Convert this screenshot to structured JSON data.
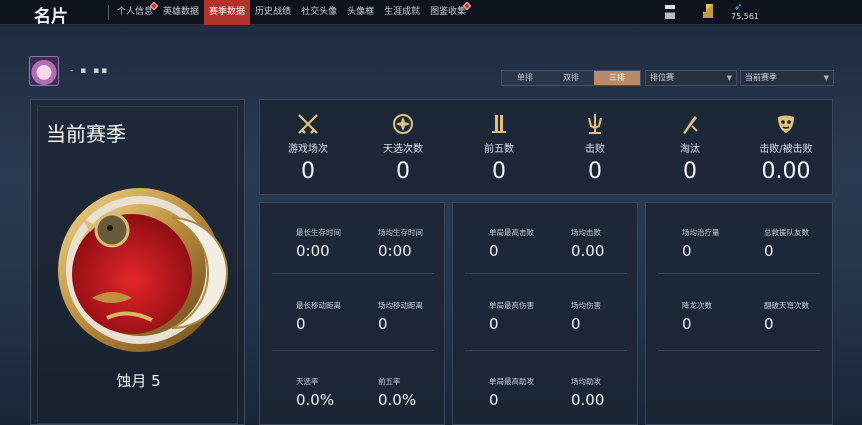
{
  "header": {
    "title": "名片",
    "tabs": [
      {
        "label": "个人信息",
        "badge": true,
        "active": false
      },
      {
        "label": "英雄数据",
        "badge": false,
        "active": false
      },
      {
        "label": "赛季数据",
        "badge": false,
        "active": true
      },
      {
        "label": "历史战绩",
        "badge": false,
        "active": false
      },
      {
        "label": "社交头像",
        "badge": false,
        "active": false
      },
      {
        "label": "头像框",
        "badge": false,
        "active": false
      },
      {
        "label": "生涯成就",
        "badge": false,
        "active": false
      },
      {
        "label": "图鉴收集",
        "badge": true,
        "active": false
      }
    ],
    "currency_value": "75,561"
  },
  "player": {
    "name": "- ▪ ▪▪"
  },
  "filters": {
    "modes": [
      "单排",
      "双排",
      "三排"
    ],
    "active_mode": "三排",
    "queue_select": "排位赛",
    "season_select": "当前赛季"
  },
  "season_panel": {
    "title": "当前赛季",
    "rank_name": "蚀月 5"
  },
  "top_stats": [
    {
      "icon": "crossed-swords-icon",
      "label": "游戏场次",
      "value": "0"
    },
    {
      "icon": "lotus-emblem-icon",
      "label": "天选次数",
      "value": "0"
    },
    {
      "icon": "pillars-icon",
      "label": "前五数",
      "value": "0"
    },
    {
      "icon": "trident-icon",
      "label": "击败",
      "value": "0"
    },
    {
      "icon": "broken-blade-icon",
      "label": "淘汰",
      "value": "0"
    },
    {
      "icon": "mask-icon",
      "label": "击败/被击败",
      "value": "0.00"
    }
  ],
  "grid_panels": [
    {
      "cells": [
        {
          "label": "最长生存时间",
          "value": "0:00"
        },
        {
          "label": "场均生存时间",
          "value": "0:00"
        },
        {
          "label": "最长移动距离",
          "value": "0"
        },
        {
          "label": "场均移动距离",
          "value": "0"
        },
        {
          "label": "天选率",
          "value": "0.0%"
        },
        {
          "label": "前五率",
          "value": "0.0%"
        }
      ]
    },
    {
      "cells": [
        {
          "label": "单局最高击败",
          "value": "0"
        },
        {
          "label": "场均击败",
          "value": "0.00"
        },
        {
          "label": "单局最高伤害",
          "value": "0"
        },
        {
          "label": "场均伤害",
          "value": "0"
        },
        {
          "label": "单局最高助攻",
          "value": "0"
        },
        {
          "label": "场均助攻",
          "value": "0.00"
        }
      ]
    },
    {
      "cells": [
        {
          "label": "场均治疗量",
          "value": "0"
        },
        {
          "label": "总救援队友数",
          "value": "0"
        },
        {
          "label": "降龙次数",
          "value": "0"
        },
        {
          "label": "翻破天穹次数",
          "value": "0"
        }
      ]
    }
  ],
  "colors": {
    "active_tab": "#b3322c",
    "active_mode": "#b78a6a",
    "emblem_red": "#c9151b"
  }
}
